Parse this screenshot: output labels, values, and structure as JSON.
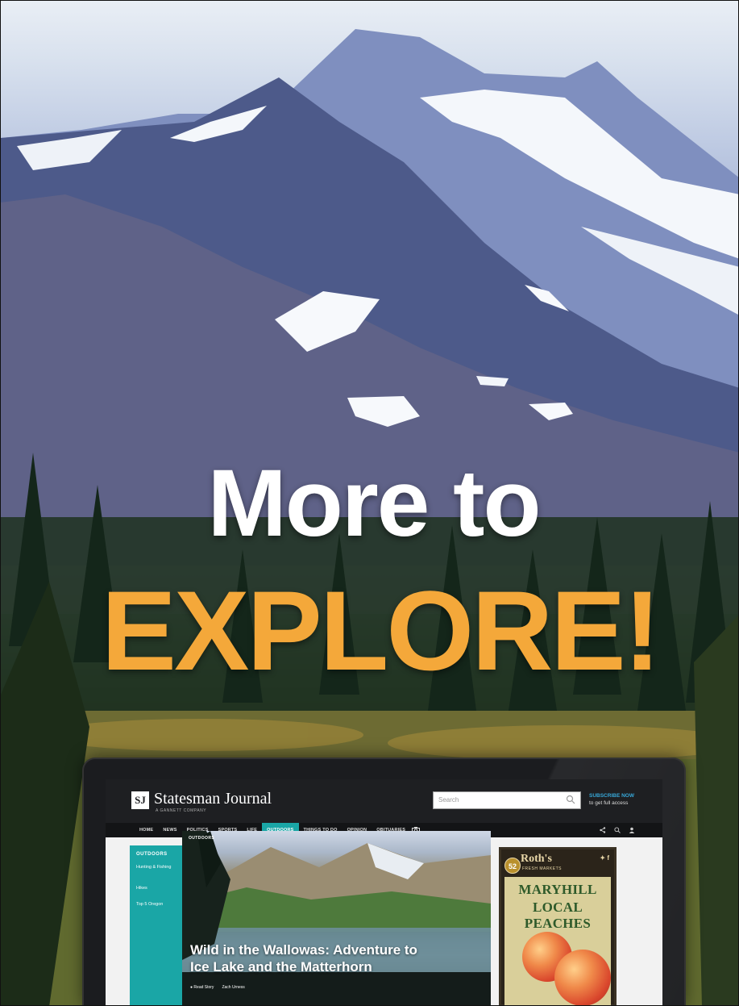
{
  "headline": {
    "line1": "More to",
    "line2": "EXPLORE!",
    "line2_color": "#f4a83a"
  },
  "site": {
    "logo_mark": "SJ",
    "name": "Statesman Journal",
    "subtitle": "A GANNETT COMPANY",
    "search_placeholder": "Search",
    "subscribe_line1": "SUBSCRIBE NOW",
    "subscribe_line2": "to get full access",
    "accent": "#1aa6a6",
    "nav": [
      "HOME",
      "NEWS",
      "POLITICS",
      "SPORTS",
      "LIFE",
      "OUTDOORS",
      "THINGS TO DO",
      "OPINION",
      "OBITUARIES"
    ],
    "nav_active": "OUTDOORS",
    "nav_tools": [
      "share-icon",
      "search-icon",
      "user-icon"
    ]
  },
  "sidebar": {
    "title": "OUTDOORS",
    "links": [
      "Hunting & Fishing",
      "Hikes",
      "Top 5 Oregon"
    ]
  },
  "hero": {
    "tag": "OUTDOORS",
    "title": "Wild in the Wallowas: Adventure to Ice Lake and the Matterhorn",
    "read_story": "Read Story",
    "byline": "Zach Urness"
  },
  "ad": {
    "badge": "52",
    "brand": "Roth's",
    "brand_sub": "FRESH MARKETS",
    "line1": "MARYHILL",
    "line2": "LOCAL PEACHES"
  }
}
